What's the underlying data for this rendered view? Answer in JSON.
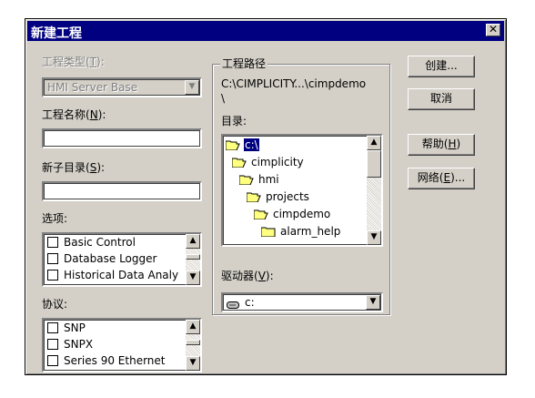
{
  "window": {
    "title": "新建工程",
    "close_glyph": "✕"
  },
  "project_type": {
    "label_text": "工程类型",
    "label_hotkey": "T",
    "value": "HMI Server Base"
  },
  "project_name": {
    "label_text": "工程名称",
    "label_hotkey": "N",
    "value": ""
  },
  "subdirectory": {
    "label_text": "新子目录",
    "label_hotkey": "S",
    "value": ""
  },
  "options": {
    "label": "选项:",
    "items": [
      "Basic Control",
      "Database Logger",
      "Historical Data Analy"
    ]
  },
  "protocols": {
    "label": "协议:",
    "items": [
      "SNP",
      "SNPX",
      "Series 90 Ethernet"
    ]
  },
  "project_path": {
    "group_title": "工程路径",
    "path_line1": "C:\\CIMPLICITY...\\cimpdemo",
    "path_line2": "\\",
    "dir_label": "目录:",
    "directories": [
      "c:\\",
      "cimplicity",
      "hmi",
      "projects",
      "cimpdemo",
      "alarm_help"
    ],
    "selected_directory": "c:\\",
    "drive_label_text": "驱动器",
    "drive_label_hotkey": "V",
    "drive_value": "c:"
  },
  "buttons": {
    "create": "创建...",
    "cancel": "取消",
    "help_text": "帮助",
    "help_hotkey": "H",
    "network_text": "网络",
    "network_hotkey": "E"
  },
  "icons": {
    "scroll_up": "▲",
    "scroll_down": "▼"
  },
  "colors": {
    "title_bar": "#000080",
    "dialog_face": "#d4d0c8",
    "selection": "#000080"
  }
}
